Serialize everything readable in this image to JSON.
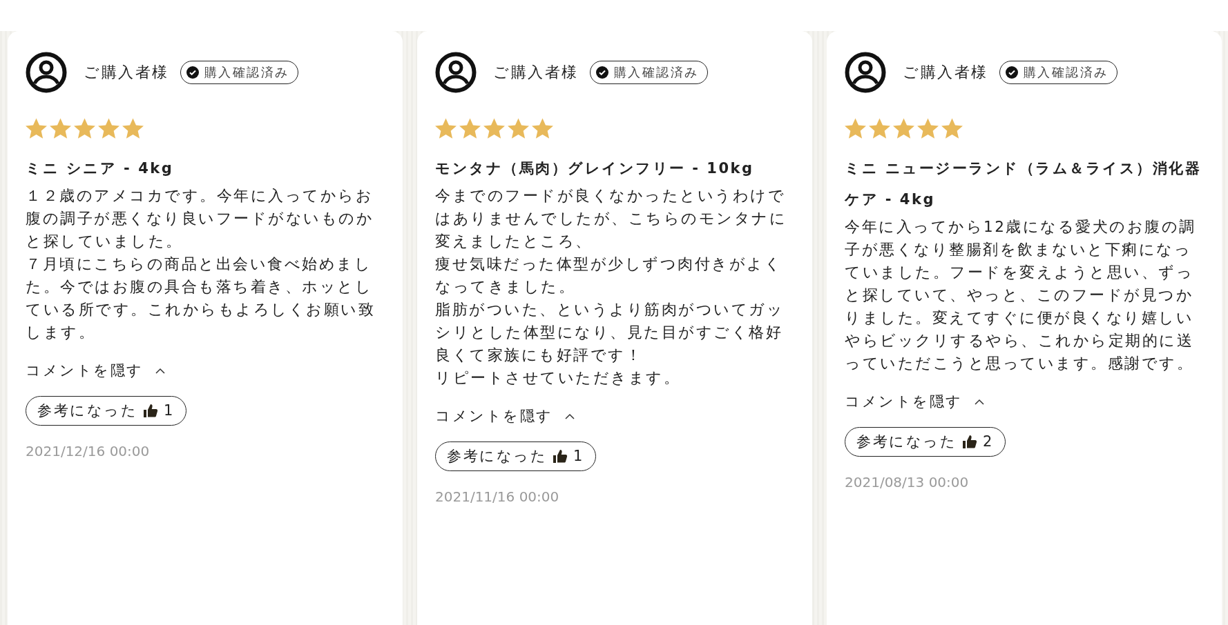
{
  "reviews": [
    {
      "reviewer": "ご購入者様",
      "badge": "購入確認済み",
      "stars": 5,
      "product": "ミニ シニア - 4kg",
      "comment": [
        "１２歳のアメコカです。今年に入ってからお腹の調子が悪くなり良いフードがないものかと探していました。",
        "７月頃にこちらの商品と出会い食べ始めました。今ではお腹の具合も落ち着き、ホッとしている所です。これからもよろしくお願い致します。"
      ],
      "toggle": "コメントを隠す",
      "expanded": true,
      "helpful_label": "参考になった",
      "helpful_count": "1",
      "date": "2021/12/16 00:00"
    },
    {
      "reviewer": "ご購入者様",
      "badge": "購入確認済み",
      "stars": 5,
      "product": "モンタナ（馬肉）グレインフリー - 10kg",
      "comment": [
        "今までのフードが良くなかったというわけではありませんでしたが、こちらのモンタナに変えましたところ、",
        "痩せ気味だった体型が少しずつ肉付きがよくなってきました。",
        "脂肪がついた、というより筋肉がついてガッシリとした体型になり、見た目がすごく格好良くて家族にも好評です！",
        "リピートさせていただきます。"
      ],
      "toggle": "コメントを隠す",
      "expanded": true,
      "helpful_label": "参考になった",
      "helpful_count": "1",
      "date": "2021/11/16 00:00"
    },
    {
      "reviewer": "ご購入者様",
      "badge": "購入確認済み",
      "stars": 5,
      "product": "ミニ ニュージーランド（ラム＆ライス）消化器ケア - 4kg",
      "comment": [
        "今年に入ってから12歳になる愛犬のお腹の調子が悪くなり整腸剤を飲まないと下痢になっていました。フードを変えようと思い、ずっと探していて、やっと、このフードが見つかりました。変えてすぐに便が良くなり嬉しいやらビックリするやら、これから定期的に送っていただこうと思っています。感謝です。"
      ],
      "toggle": "コメントを隠す",
      "expanded": true,
      "helpful_label": "参考になった",
      "helpful_count": "2",
      "date": "2021/08/13 00:00"
    }
  ]
}
